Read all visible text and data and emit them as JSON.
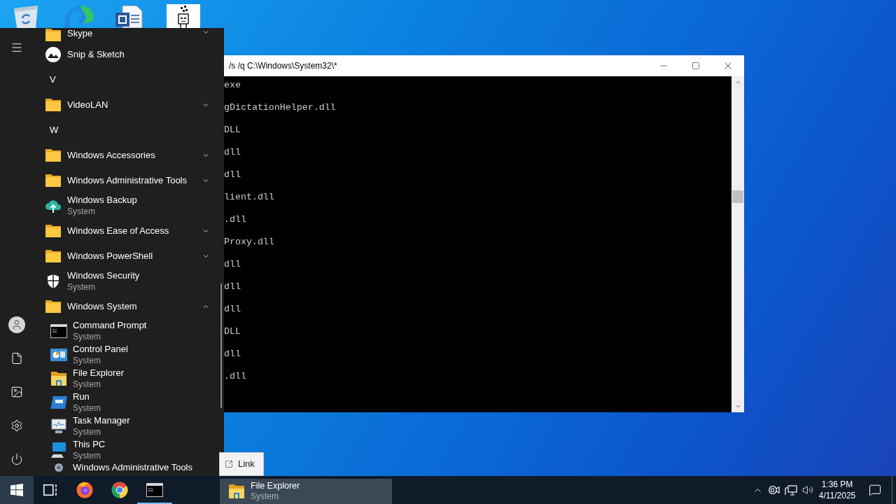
{
  "start_menu": {
    "apps": [
      {
        "kind": "folder",
        "label": "Skype",
        "expanded": false
      },
      {
        "kind": "snip",
        "label": "Snip & Sketch"
      },
      {
        "kind": "letter",
        "label": "V"
      },
      {
        "kind": "folder",
        "label": "VideoLAN",
        "expanded": false
      },
      {
        "kind": "letter",
        "label": "W"
      },
      {
        "kind": "folder",
        "label": "Windows Accessories",
        "expanded": false
      },
      {
        "kind": "folder",
        "label": "Windows Administrative Tools",
        "expanded": false
      },
      {
        "kind": "backup",
        "label": "Windows Backup",
        "subtitle": "System"
      },
      {
        "kind": "folder",
        "label": "Windows Ease of Access",
        "expanded": false
      },
      {
        "kind": "folder",
        "label": "Windows PowerShell",
        "expanded": false
      },
      {
        "kind": "security",
        "label": "Windows Security",
        "subtitle": "System"
      },
      {
        "kind": "folder",
        "label": "Windows System",
        "expanded": true,
        "children": [
          {
            "kind": "terminal",
            "label": "Command Prompt",
            "subtitle": "System"
          },
          {
            "kind": "panel",
            "label": "Control Panel",
            "subtitle": "System"
          },
          {
            "kind": "explorer",
            "label": "File Explorer",
            "subtitle": "System"
          },
          {
            "kind": "run",
            "label": "Run",
            "subtitle": "System"
          },
          {
            "kind": "monitor",
            "label": "Task Manager",
            "subtitle": "System"
          },
          {
            "kind": "computer",
            "label": "This PC",
            "subtitle": "System"
          },
          {
            "kind": "tools",
            "label": "Windows Administrative Tools"
          }
        ]
      }
    ]
  },
  "console": {
    "title": "/s /q C:\\Windows\\System32\\*",
    "lines": [
      "exe",
      "gDictationHelper.dll",
      "DLL",
      "dll",
      "dll",
      "lient.dll",
      ".dll",
      "Proxy.dll",
      "dll",
      "dll",
      "dll",
      "DLL",
      "dll",
      ".dll"
    ]
  },
  "drag": {
    "tooltip": "Link",
    "title": "File Explorer",
    "subtitle": "System"
  },
  "taskbar": {
    "start_open": true,
    "apps": [
      {
        "kind": "taskview",
        "running": false
      },
      {
        "kind": "firefox",
        "running": false
      },
      {
        "kind": "chrome",
        "running": false
      },
      {
        "kind": "terminal",
        "running": true
      }
    ],
    "clock": {
      "time": "1:36 PM",
      "date": "4/11/2025"
    }
  }
}
